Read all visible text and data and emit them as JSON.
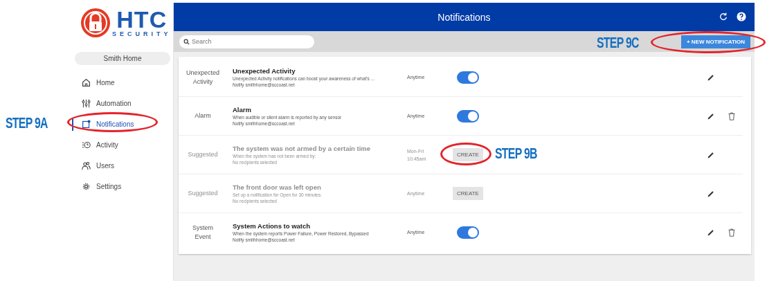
{
  "logo": {
    "brand": "HTC",
    "tagline": "SECURITY"
  },
  "header": {
    "title": "Notifications"
  },
  "sidebar": {
    "location": "Smith Home",
    "items": [
      {
        "label": "Home",
        "selected": false
      },
      {
        "label": "Automation",
        "selected": false
      },
      {
        "label": "Notifications",
        "selected": true
      },
      {
        "label": "Activity",
        "selected": false
      },
      {
        "label": "Users",
        "selected": false
      },
      {
        "label": "Settings",
        "selected": false
      }
    ]
  },
  "search": {
    "placeholder": "Search"
  },
  "new_button": {
    "label": "+ NEW NOTIFICATION"
  },
  "notifications": [
    {
      "category": "Unexpected Activity",
      "title": "Unexpected Activity",
      "description": "Unexpected Activity notifications can boost your awareness of what's ...",
      "recipients": "Notify smithhome@sccoast.net",
      "schedule": "Anytime",
      "kind": "toggle",
      "on": true,
      "disabled": false,
      "deletable": false
    },
    {
      "category": "Alarm",
      "title": "Alarm",
      "description": "When audible or silent alarm is reported by any sensor",
      "recipients": "Notify smithhome@sccoast.net",
      "schedule": "Anytime",
      "kind": "toggle",
      "on": true,
      "disabled": false,
      "deletable": true
    },
    {
      "category": "Suggested",
      "title": "The system was not armed by a certain time",
      "description": "When the system has not been armed by:",
      "recipients": "No recipients selected",
      "schedule": "Mon-Fri 10:45am",
      "kind": "create",
      "action": "CREATE",
      "disabled": true,
      "deletable": false
    },
    {
      "category": "Suggested",
      "title": "The front door was left open",
      "description": "Set up a notification for Open for 30 minutes.",
      "recipients": "No recipients selected",
      "schedule": "Anytime",
      "kind": "create",
      "action": "CREATE",
      "disabled": true,
      "deletable": false
    },
    {
      "category": "System Event",
      "title": "System Actions to watch",
      "description": "When the system reports Power Failure, Power Restored, Bypassed",
      "recipients": "Notify smithhome@sccoast.net",
      "schedule": "Anytime",
      "kind": "toggle",
      "on": true,
      "disabled": false,
      "deletable": true
    }
  ],
  "annotations": [
    {
      "label": "STEP 9A"
    },
    {
      "label": "STEP 9B"
    },
    {
      "label": "STEP 9C"
    }
  ]
}
